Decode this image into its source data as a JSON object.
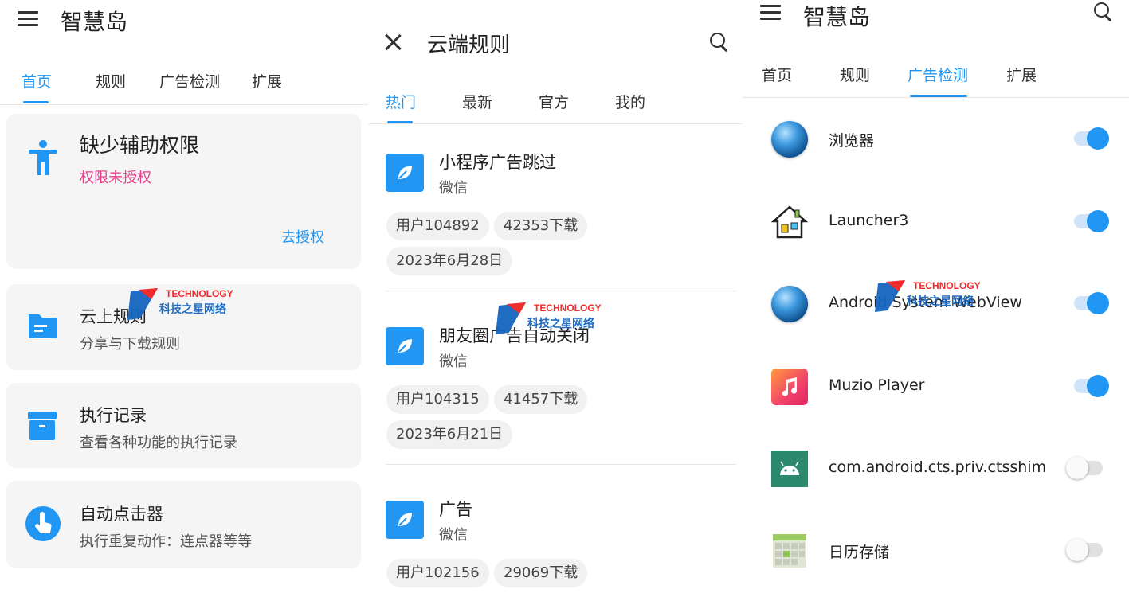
{
  "colors": {
    "accent": "#2196f3",
    "pink": "#e83e8c",
    "card_bg": "#f5f5f5"
  },
  "home": {
    "title": "智慧岛",
    "tabs": [
      "首页",
      "规则",
      "广告检测",
      "扩展"
    ],
    "active_tab": 0,
    "cards": [
      {
        "icon": "accessibility-icon",
        "title": "缺少辅助权限",
        "subtitle": "权限未授权",
        "action": "去授权"
      },
      {
        "icon": "folder-icon",
        "title": "云上规则",
        "subtitle": "分享与下载规则"
      },
      {
        "icon": "history-box-icon",
        "title": "执行记录",
        "subtitle": "查看各种功能的执行记录"
      },
      {
        "icon": "tap-icon",
        "title": "自动点击器",
        "subtitle": "执行重复动作：连点器等等"
      }
    ]
  },
  "cloud": {
    "title": "云端规则",
    "tabs": [
      "热门",
      "最新",
      "官方",
      "我的"
    ],
    "active_tab": 0,
    "rules": [
      {
        "icon": "leaf-icon",
        "title": "小程序广告跳过",
        "app": "微信",
        "user": "用户104892",
        "downloads": "42353下载",
        "date": "2023年6月28日"
      },
      {
        "icon": "leaf-icon",
        "title": "朋友圈广告自动关闭",
        "app": "微信",
        "user": "用户104315",
        "downloads": "41457下载",
        "date": "2023年6月21日"
      },
      {
        "icon": "leaf-icon",
        "title": "广告",
        "app": "微信",
        "user": "用户102156",
        "downloads": "29069下载"
      }
    ]
  },
  "adcheck": {
    "title": "智慧岛",
    "tabs": [
      "首页",
      "规则",
      "广告检测",
      "扩展"
    ],
    "active_tab": 2,
    "apps": [
      {
        "icon": "globe-icon",
        "name": "浏览器",
        "enabled": true
      },
      {
        "icon": "launcher-house-icon",
        "name": "Launcher3",
        "enabled": true
      },
      {
        "icon": "globe-icon",
        "name": "Android System WebView",
        "enabled": true
      },
      {
        "icon": "music-note-icon",
        "name": "Muzio Player",
        "enabled": true
      },
      {
        "icon": "android-icon",
        "name": "com.android.cts.priv.ctsshim",
        "enabled": false
      },
      {
        "icon": "calendar-grid-icon",
        "name": "日历存储",
        "enabled": false
      }
    ]
  },
  "watermark": {
    "en": "TECHNOLOGY",
    "cn": "科技之星网络"
  }
}
